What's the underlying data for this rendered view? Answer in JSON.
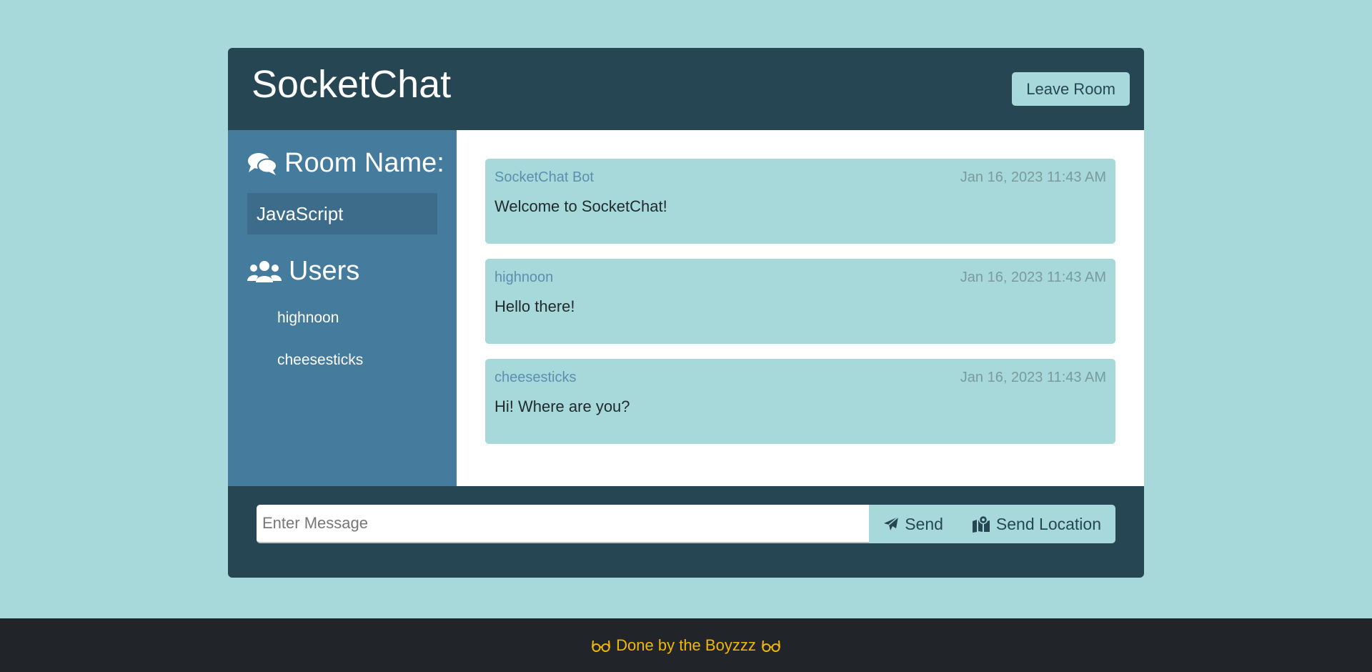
{
  "header": {
    "title": "SocketChat",
    "leave_label": "Leave Room"
  },
  "sidebar": {
    "room_heading": "Room Name:",
    "room_name": "JavaScript",
    "users_heading": "Users",
    "users": [
      "highnoon",
      "cheesesticks"
    ]
  },
  "messages": [
    {
      "user": "SocketChat Bot",
      "time": "Jan 16, 2023 11:43 AM",
      "text": "Welcome to SocketChat!"
    },
    {
      "user": "highnoon",
      "time": "Jan 16, 2023 11:43 AM",
      "text": "Hello there!"
    },
    {
      "user": "cheesesticks",
      "time": "Jan 16, 2023 11:43 AM",
      "text": "Hi! Where are you?"
    }
  ],
  "form": {
    "placeholder": "Enter Message",
    "send_label": "Send",
    "location_label": "Send Location"
  },
  "footer": {
    "text": "Done by the Boyzzz"
  },
  "icons": {
    "room": "comments-icon",
    "users": "users-icon",
    "send": "paper-plane-icon",
    "location": "map-location-icon",
    "footer": "glasses-icon"
  },
  "colors": {
    "background": "#a8d9da",
    "header": "#264653",
    "sidebar": "#457b9d",
    "footer": "#212529",
    "footer_text": "#f2b705"
  }
}
